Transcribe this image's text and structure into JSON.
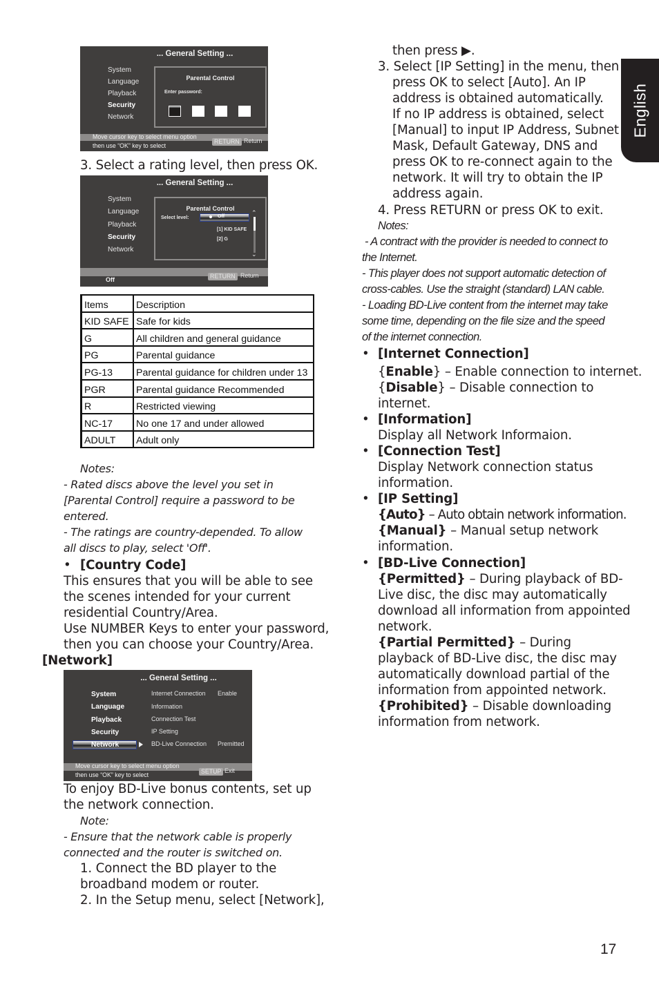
{
  "side_tab": {
    "label": "English"
  },
  "page_number": "17",
  "osd_common": {
    "title": "... General Setting ...",
    "menu": [
      "System",
      "Language",
      "Playback",
      "Security",
      "Network"
    ]
  },
  "osd_password": {
    "panel_title": "Parental Control",
    "prompt": "Enter password:",
    "hint_line1": "Move cursor key to select menu option",
    "hint_line2": "then use “OK” key to select",
    "key": "RETURN",
    "key_label": "Return"
  },
  "step3_caption": "3. Select a rating level, then press OK.",
  "osd_level": {
    "panel_title": "Parental Control",
    "select_label": "Select level:",
    "selected_value": "Off",
    "options": [
      "[1] KID SAFE",
      "[2] G"
    ],
    "status": "Off",
    "key": "RETURN",
    "key_label": "Return"
  },
  "ratings_table": {
    "headers": [
      "Items",
      "Description"
    ],
    "rows": [
      [
        "KID SAFE",
        "Safe for kids"
      ],
      [
        "G",
        "All children and general guidance"
      ],
      [
        "PG",
        "Parental guidance"
      ],
      [
        "PG-13",
        "Parental guidance for children under 13"
      ],
      [
        "PGR",
        "Parental guidance Recommended"
      ],
      [
        "R",
        "Restricted viewing"
      ],
      [
        "NC-17",
        "No one 17 and under allowed"
      ],
      [
        "ADULT",
        "Adult only"
      ]
    ]
  },
  "notes_left": {
    "heading": "Notes:",
    "lines": [
      "- Rated discs above the level you set in",
      "[Parental Control] require a password to be",
      "entered.",
      "- The ratings are country-depended. To allow",
      "all discs to play, select 'Off'."
    ]
  },
  "country_code": {
    "bullet": "•",
    "heading": "[Country Code]",
    "lines": [
      "This ensures that you will be able to see",
      "the scenes intended for your current",
      "residential  Country/Area.",
      "Use NUMBER Keys to enter your password,",
      "then you can choose your Country/Area."
    ]
  },
  "network_heading": "[Network]",
  "osd_network": {
    "menu_items": [
      {
        "label": "Internet Connection",
        "value": "Enable"
      },
      {
        "label": "Information",
        "value": ""
      },
      {
        "label": "Connection Test",
        "value": ""
      },
      {
        "label": "IP Setting",
        "value": ""
      },
      {
        "label": "BD-Live Connection",
        "value": "Premitted"
      }
    ],
    "hint_line1": "Move cursor key to select menu option",
    "hint_line2": "then use “OK” key to select",
    "key": "SETUP",
    "key_label": "Exit"
  },
  "network_intro": {
    "lines": [
      "To enjoy BD-Live bonus contents, set up",
      "the network connection."
    ],
    "note_heading": "Note:",
    "note_lines": [
      "- Ensure that the network cable is properly",
      "connected and the router is switched on."
    ],
    "steps": [
      "1. Connect the BD player to the",
      "broadband modem or router.",
      "2. In the Setup menu, select [Network],"
    ]
  },
  "right_steps": {
    "line0": "then press ▶.",
    "step3": [
      "3. Select [IP Setting] in the menu, then",
      "press OK to select [Auto]. An IP",
      "address is obtained automatically.",
      "If no IP address is obtained, select",
      "[Manual] to input IP Address, Subnet",
      "Mask, Default Gateway, DNS and",
      "press OK to re-connect again to the",
      "network. It will try to obtain the IP",
      "address again."
    ],
    "step4": "4. Press RETURN or press OK to exit."
  },
  "notes_right": {
    "heading": "Notes:",
    "lines": [
      " - A contract with the provider is needed to connect to",
      "the Internet.",
      "- This player does not support automatic detection of",
      "cross-cables. Use the straight (standard) LAN cable.",
      "- Loading BD-Live content from the internet may take",
      "some time, depending on the file size and the speed",
      "of the internet connection."
    ]
  },
  "sections": {
    "internet_connection": {
      "heading": "[Internet Connection]",
      "enable_key": "Enable",
      "enable_desc": " – Enable connection to internet.",
      "disable_key": "Disable",
      "disable_desc": " – Disable connection to",
      "disable_desc2": "internet."
    },
    "information": {
      "heading": "[Information]",
      "desc": "Display all Network Informaion."
    },
    "connection_test": {
      "heading": "[Connection Test]",
      "desc1": "Display Network connection status",
      "desc2": "information."
    },
    "ip_setting": {
      "heading": "[IP Setting]",
      "auto_key": "{Auto}",
      "auto_desc": " – Auto obtain network information.",
      "manual_key": "{Manual}",
      "manual_desc": " – Manual setup network",
      "manual_desc2": "information."
    },
    "bd_live": {
      "heading": "[BD-Live Connection]",
      "permitted_key": "{Permitted}",
      "permitted_desc": " – During playback of BD-",
      "permitted_lines": [
        "Live disc, the disc may automatically",
        "download all information from appointed",
        "network."
      ],
      "partial_key": "{Partial Permitted}",
      "partial_desc": " – During",
      "partial_lines": [
        "playback of BD-Live disc, the disc may",
        "automatically download partial of the",
        "information from appointed network."
      ],
      "prohibited_key": "{Prohibited}",
      "prohibited_desc": " – Disable downloading",
      "prohibited_lines": [
        "information from network."
      ]
    },
    "bullet": "•"
  }
}
